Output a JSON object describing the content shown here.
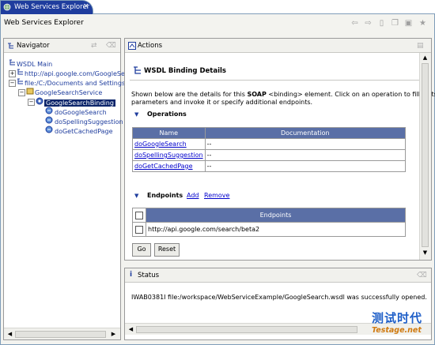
{
  "editor": {
    "tab_label": "Web Services Explorer",
    "tab_close": "×",
    "title": "Web Services Explorer"
  },
  "toolbar_icons": [
    "back-icon",
    "forward-icon",
    "page-icon",
    "copy-icon",
    "favorites-icon",
    "star-icon"
  ],
  "navigator": {
    "title": "Navigator",
    "items": [
      {
        "label": "WSDL Main"
      },
      {
        "label": "http://api.google.com/GoogleSe"
      },
      {
        "label": "file:/C:/Documents and Settings"
      },
      {
        "label": "GoogleSearchService"
      },
      {
        "label": "GoogleSearchBinding"
      },
      {
        "label": "doGoogleSearch"
      },
      {
        "label": "doSpellingSuggestion"
      },
      {
        "label": "doGetCachedPage"
      }
    ]
  },
  "actions": {
    "title": "Actions",
    "heading": "WSDL Binding Details",
    "desc_line1_pre": "Shown below are the details for this ",
    "desc_line1_bold": "SOAP",
    "desc_line1_post": " <binding> element. Click on an operation to fill in its",
    "desc_line2": "parameters and invoke it or specify additional endpoints.",
    "operations": {
      "label": "Operations",
      "columns": [
        "Name",
        "Documentation"
      ],
      "rows": [
        {
          "name": "doGoogleSearch",
          "doc": "--"
        },
        {
          "name": "doSpellingSuggestion",
          "doc": "--"
        },
        {
          "name": "doGetCachedPage",
          "doc": "--"
        }
      ]
    },
    "endpoints": {
      "label": "Endpoints",
      "add": "Add",
      "remove": "Remove",
      "column": "Endpoints",
      "rows": [
        {
          "url": "http://api.google.com/search/beta2"
        }
      ]
    },
    "go": "Go",
    "reset": "Reset"
  },
  "status": {
    "title": "Status",
    "message": "IWAB0381I file:/workspace/WebServiceExample/GoogleSearch.wsdl was successfully opened."
  },
  "watermark": {
    "text": "测试时代",
    "sub": "Testage.net"
  },
  "colors": {
    "tab_active": "#1f3d9e",
    "table_header": "#5a6fa6",
    "link": "#0000cc",
    "selection": "#0a246a"
  }
}
